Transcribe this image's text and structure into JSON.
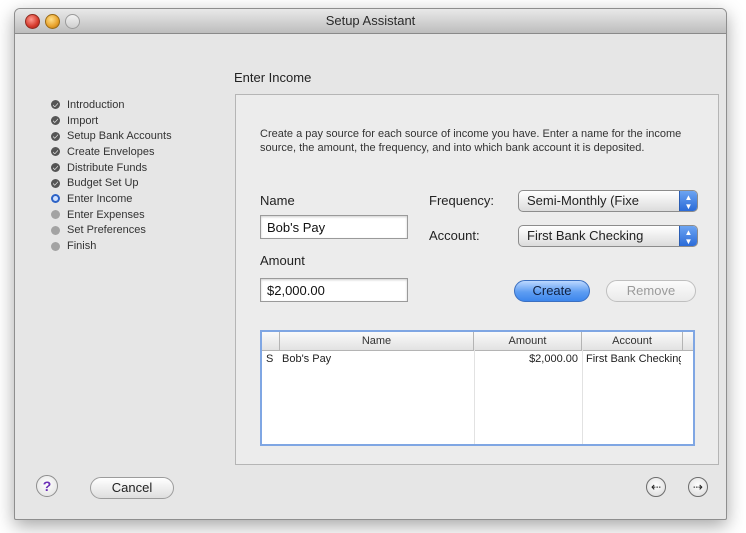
{
  "window": {
    "title": "Setup Assistant"
  },
  "steps": [
    {
      "label": "Introduction",
      "state": "done"
    },
    {
      "label": "Import",
      "state": "done"
    },
    {
      "label": "Setup Bank Accounts",
      "state": "done"
    },
    {
      "label": "Create Envelopes",
      "state": "done"
    },
    {
      "label": "Distribute Funds",
      "state": "done"
    },
    {
      "label": "Budget Set Up",
      "state": "done"
    },
    {
      "label": "Enter Income",
      "state": "current"
    },
    {
      "label": "Enter Expenses",
      "state": "pending"
    },
    {
      "label": "Set Preferences",
      "state": "pending"
    },
    {
      "label": "Finish",
      "state": "pending"
    }
  ],
  "section": {
    "title": "Enter Income"
  },
  "form": {
    "description": "Create a pay source for each source of income you have.  Enter a name for the income source, the amount, the frequency, and into which bank account it is deposited.",
    "name_label": "Name",
    "name_value": "Bob's Pay",
    "amount_label": "Amount",
    "amount_value": "$2,000.00",
    "frequency_label": "Frequency:",
    "frequency_value": "Semi-Monthly (Fixe",
    "account_label": "Account:",
    "account_value": "First Bank Checking",
    "create_label": "Create",
    "remove_label": "Remove"
  },
  "table": {
    "columns": [
      "",
      "Name",
      "Amount",
      "Account"
    ],
    "rows": [
      {
        "marker": "S",
        "name": "Bob's Pay",
        "amount": "$2,000.00",
        "account": "First Bank Checking"
      }
    ]
  },
  "footer": {
    "help_label": "?",
    "cancel_label": "Cancel",
    "back_glyph": "⇠",
    "forward_glyph": "⇢"
  },
  "colors": {
    "accent": "#3d86ec",
    "current_step": "#2b62c6",
    "help_icon": "#6b2fb6"
  }
}
